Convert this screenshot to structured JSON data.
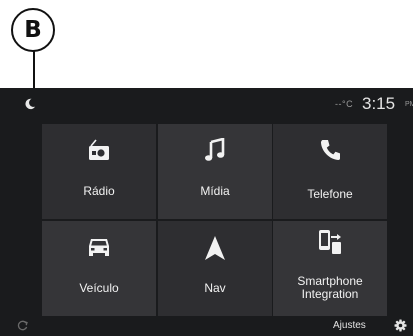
{
  "callout": {
    "letter": "B"
  },
  "status": {
    "time": "3:15",
    "ampm": "PM",
    "temp": "--°C"
  },
  "tiles": [
    {
      "label": "Rádio",
      "icon": "radio-icon"
    },
    {
      "label": "Mídia",
      "icon": "music-note-icon"
    },
    {
      "label": "Telefone",
      "icon": "phone-icon"
    },
    {
      "label": "Veículo",
      "icon": "car-icon"
    },
    {
      "label": "Nav",
      "icon": "navigation-arrow-icon"
    },
    {
      "label": "Smartphone Integration",
      "icon": "smartphone-projection-icon"
    }
  ],
  "bottom": {
    "settings_label": "Ajustes"
  },
  "colors": {
    "screen_bg": "#1a1b1d",
    "tile_bg": "#2e2e31",
    "text": "#f2f2f2"
  }
}
